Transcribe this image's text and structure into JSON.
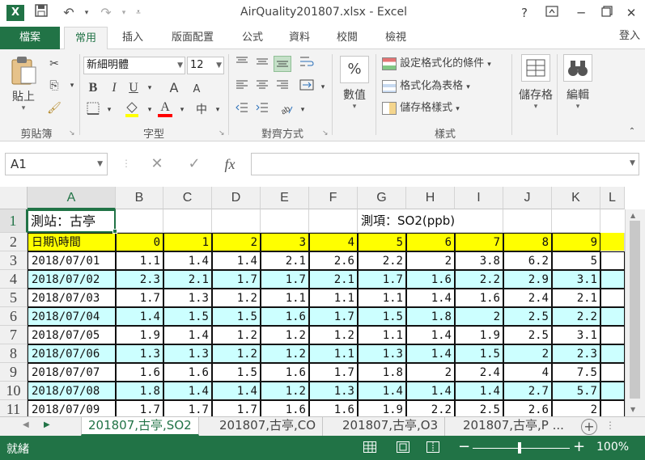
{
  "window": {
    "title": "AirQuality201807.xlsx - Excel",
    "app_icon": "X",
    "help": "?",
    "minimize": "─",
    "close": "✕"
  },
  "ribbon_tabs": {
    "file": "檔案",
    "tabs": [
      "常用",
      "插入",
      "版面配置",
      "公式",
      "資料",
      "校閱",
      "檢視"
    ],
    "login": "登入"
  },
  "ribbon": {
    "clipboard": {
      "paste": "貼上",
      "label": "剪貼簿"
    },
    "font": {
      "name": "新細明體",
      "size": "12",
      "bold": "B",
      "italic": "I",
      "underline": "U",
      "grow": "A",
      "shrink": "A",
      "font_color": "A",
      "phonetic": "中",
      "label": "字型"
    },
    "alignment": {
      "label": "對齊方式"
    },
    "number": {
      "percent": "%",
      "label_btn": "數值"
    },
    "styles": {
      "conditional": "設定格式化的條件",
      "as_table": "格式化為表格",
      "cell_styles": "儲存格樣式",
      "label": "樣式"
    },
    "cells": {
      "label": "儲存格"
    },
    "editing": {
      "label": "編輯"
    }
  },
  "formula_bar": {
    "name_box": "A1",
    "cancel": "✕",
    "enter": "✓",
    "fx": "fx",
    "value": ""
  },
  "sheet": {
    "columns": [
      "A",
      "B",
      "C",
      "D",
      "E",
      "F",
      "G",
      "H",
      "I",
      "J",
      "K",
      "L"
    ],
    "rows": [
      "1",
      "2",
      "3",
      "4",
      "5",
      "6",
      "7",
      "8",
      "9",
      "10",
      "11"
    ],
    "r1_a": "測站：古亭",
    "r1_g": "測項：SO2(ppb)",
    "r2_a": "日期\\時間",
    "hours": [
      "0",
      "1",
      "2",
      "3",
      "4",
      "5",
      "6",
      "7",
      "8",
      "9"
    ],
    "data": [
      {
        "date": "2018/07/01",
        "v": [
          "1.1",
          "1.4",
          "1.4",
          "2.1",
          "2.6",
          "2.2",
          "2",
          "3.8",
          "6.2",
          "5"
        ]
      },
      {
        "date": "2018/07/02",
        "v": [
          "2.3",
          "2.1",
          "1.7",
          "1.7",
          "2.1",
          "1.7",
          "1.6",
          "2.2",
          "2.9",
          "3.1"
        ]
      },
      {
        "date": "2018/07/03",
        "v": [
          "1.7",
          "1.3",
          "1.2",
          "1.1",
          "1.1",
          "1.1",
          "1.4",
          "1.6",
          "2.4",
          "2.1"
        ]
      },
      {
        "date": "2018/07/04",
        "v": [
          "1.4",
          "1.5",
          "1.5",
          "1.6",
          "1.7",
          "1.5",
          "1.8",
          "2",
          "2.5",
          "2.2"
        ]
      },
      {
        "date": "2018/07/05",
        "v": [
          "1.9",
          "1.4",
          "1.2",
          "1.2",
          "1.2",
          "1.1",
          "1.4",
          "1.9",
          "2.5",
          "3.1"
        ]
      },
      {
        "date": "2018/07/06",
        "v": [
          "1.3",
          "1.3",
          "1.2",
          "1.2",
          "1.1",
          "1.3",
          "1.4",
          "1.5",
          "2",
          "2.3"
        ]
      },
      {
        "date": "2018/07/07",
        "v": [
          "1.6",
          "1.6",
          "1.5",
          "1.6",
          "1.7",
          "1.8",
          "2",
          "2.4",
          "4",
          "7.5"
        ]
      },
      {
        "date": "2018/07/08",
        "v": [
          "1.8",
          "1.4",
          "1.4",
          "1.2",
          "1.3",
          "1.4",
          "1.4",
          "1.4",
          "2.7",
          "5.7"
        ]
      },
      {
        "date": "2018/07/09",
        "v": [
          "1.7",
          "1.7",
          "1.7",
          "1.6",
          "1.6",
          "1.9",
          "2.2",
          "2.5",
          "2.6",
          "2"
        ]
      }
    ]
  },
  "sheet_tabs": [
    "201807,古亭,SO2",
    "201807,古亭,CO",
    "201807,古亭,O3",
    "201807,古亭,P ..."
  ],
  "status": {
    "ready": "就緒",
    "zoom_minus": "−",
    "zoom_plus": "+",
    "zoom": "100%"
  },
  "colors": {
    "accent": "#217346",
    "header_fill": "#ffff00",
    "alt_row_fill": "#ccffff"
  }
}
